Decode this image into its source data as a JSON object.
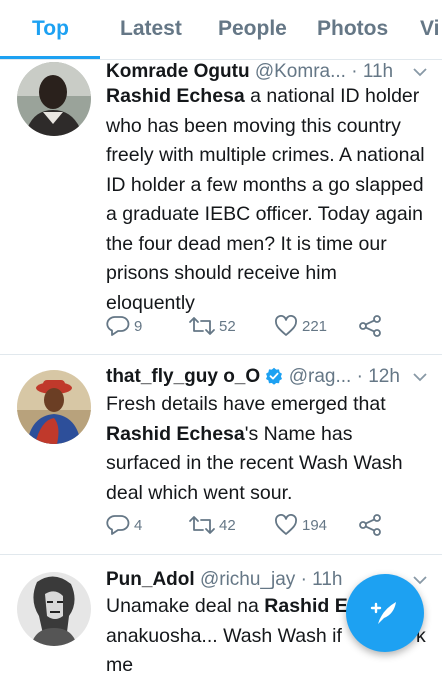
{
  "tabs": [
    {
      "label": "Top",
      "active": true
    },
    {
      "label": "Latest",
      "active": false
    },
    {
      "label": "People",
      "active": false
    },
    {
      "label": "Photos",
      "active": false
    },
    {
      "label": "Vi",
      "active": false
    }
  ],
  "tweets": [
    {
      "name": "Komrade Ogutu",
      "handle": "@Komra...",
      "time": "· 11h",
      "verified": false,
      "text_bold": "Rashid Echesa",
      "text_rest": " a national ID holder who has been moving this country freely with multiple crimes. A national ID holder a few months a go slapped a graduate IEBC officer. Today again the four dead men? It is time our prisons should receive him eloquently",
      "replies": "9",
      "retweets": "52",
      "likes": "221"
    },
    {
      "name": "that_fly_guy o_O",
      "handle": "@rag...",
      "time": "· 12h",
      "verified": true,
      "text_pre": "Fresh details have emerged that ",
      "text_bold": "Rashid Echesa",
      "text_rest": "'s Name has surfaced in the recent Wash Wash deal which went sour.",
      "replies": "4",
      "retweets": "42",
      "likes": "194"
    },
    {
      "name": "Pun_Adol",
      "handle": "@richu_jay",
      "time": "· 11h",
      "verified": false,
      "text_pre": "Unamake deal na ",
      "text_bold": "Rashid E",
      "text_rest": "anakuosha... Wash Wash if",
      "text_rest2": "k",
      "text_rest3": "me"
    }
  ],
  "icons": {
    "reply": "reply-icon",
    "retweet": "retweet-icon",
    "like": "heart-icon",
    "share": "share-icon",
    "menu": "chevron-down-icon",
    "verified": "verified-badge-icon",
    "compose": "compose-tweet-icon"
  },
  "colors": {
    "accent": "#1da1f2",
    "text": "#14171a",
    "secondary": "#657786"
  }
}
